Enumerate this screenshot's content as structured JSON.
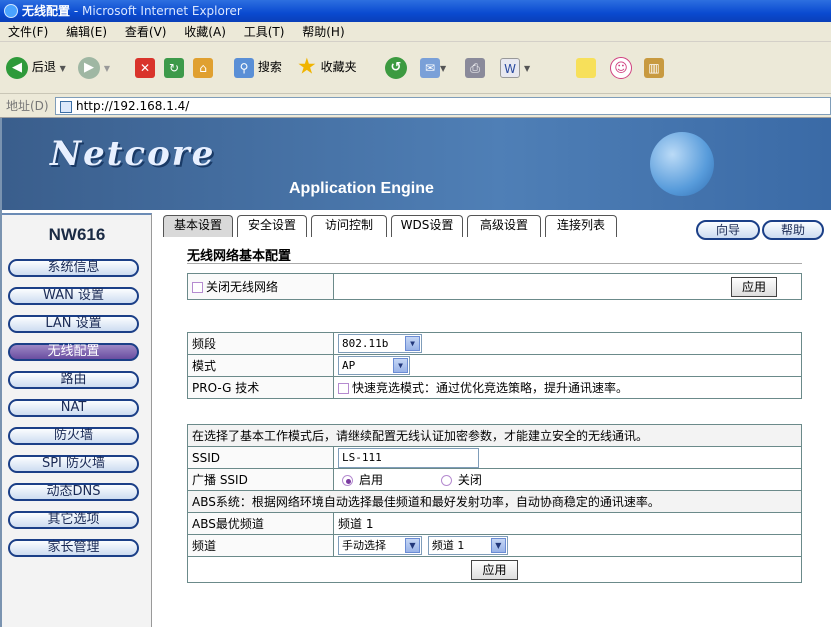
{
  "window": {
    "title_bold": "无线配置",
    "title_rest": " - Microsoft Internet Explorer"
  },
  "menu": [
    "文件(F)",
    "编辑(E)",
    "查看(V)",
    "收藏(A)",
    "工具(T)",
    "帮助(H)"
  ],
  "toolbar": {
    "back": "后退",
    "search": "搜索",
    "favorites": "收藏夹"
  },
  "address": {
    "label": "地址(D)",
    "url": "http://192.168.1.4/"
  },
  "banner": {
    "logo": "Netcore",
    "tagline": "Application Engine"
  },
  "sidebar": {
    "model": "NW616",
    "items": [
      "系统信息",
      "WAN 设置",
      "LAN 设置",
      "无线配置",
      "路由",
      "NAT",
      "防火墙",
      "SPI 防火墙",
      "动态DNS",
      "其它选项",
      "家长管理"
    ]
  },
  "tabs": [
    "基本设置",
    "安全设置",
    "访问控制",
    "WDS设置",
    "高级设置",
    "连接列表"
  ],
  "top_buttons": {
    "wizard": "向导",
    "help": "帮助"
  },
  "form": {
    "heading": "无线网络基本配置",
    "disable_wireless": "关闭无线网络",
    "apply": "应用",
    "band_label": "频段",
    "band_value": "802.11b",
    "mode_label": "模式",
    "mode_value": "AP",
    "prog_label": "PRO-G 技术",
    "prog_text": "快速竞选模式：通过优化竞选策略，提升通讯速率。",
    "notice": "在选择了基本工作模式后，请继续配置无线认证加密参数，才能建立安全的无线通讯。",
    "ssid_label": "SSID",
    "ssid_value": "LS-111",
    "broadcast_label": "广播 SSID",
    "enable": "启用",
    "disable": "关闭",
    "abs_text": "ABS系统：根据网络环境自动选择最佳频道和最好发射功率，自动协商稳定的通讯速率。",
    "abs_best_label": "ABS最优频道",
    "abs_best_value": "频道 1",
    "channel_label": "频道",
    "channel_mode": "手动选择",
    "channel_value": "频道 1",
    "apply2": "应用"
  }
}
